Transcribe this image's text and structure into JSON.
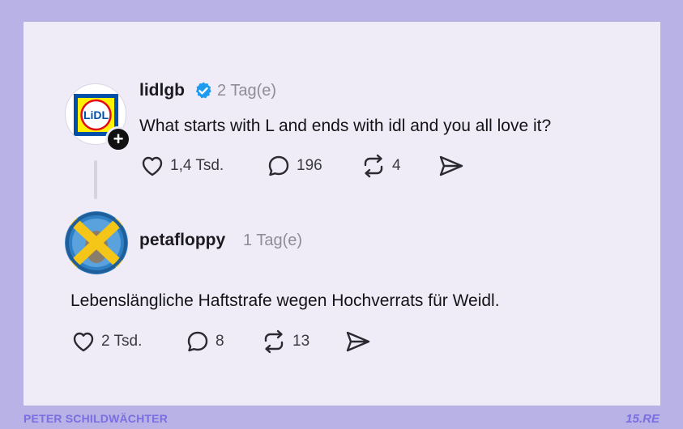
{
  "post": {
    "username": "lidlgb",
    "verified": true,
    "timestamp": "2 Tag(e)",
    "text": "What starts with L and ends with idl and you all love it?",
    "likes": "1,4 Tsd.",
    "replies": "196",
    "reposts": "4",
    "avatar_logo_text": "LIDL"
  },
  "reply": {
    "username": "petafloppy",
    "timestamp": "1 Tag(e)",
    "text": "Lebenslängliche Haftstrafe wegen Hochverrats für Weidl.",
    "likes": "2 Tsd.",
    "replies": "8",
    "reposts": "13"
  },
  "footer": {
    "left": "PETER SCHILDWÄCHTER",
    "right": "15.RE"
  },
  "colors": {
    "frame": "#b9b2e6",
    "card": "#efecf8",
    "verified_badge": "#1d9bf0",
    "footer_text": "#7a6ee0"
  }
}
